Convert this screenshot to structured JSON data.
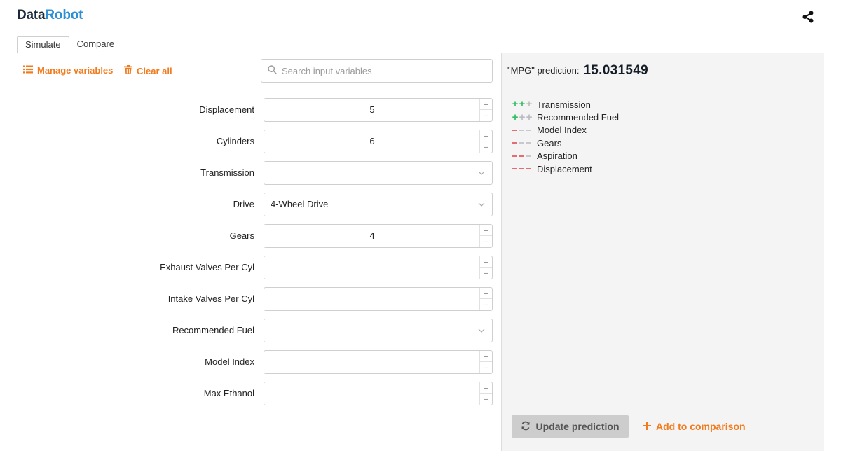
{
  "app": {
    "logo_part1": "Data",
    "logo_part2": "Robot"
  },
  "tabs": [
    {
      "label": "Simulate"
    },
    {
      "label": "Compare"
    }
  ],
  "toolbar": {
    "manage_label": "Manage variables",
    "clear_label": "Clear all",
    "search_placeholder": "Search input variables",
    "search_value": ""
  },
  "fields": [
    {
      "label": "Displacement",
      "type": "number",
      "value": "5"
    },
    {
      "label": "Cylinders",
      "type": "number",
      "value": "6"
    },
    {
      "label": "Transmission",
      "type": "select",
      "value": ""
    },
    {
      "label": "Drive",
      "type": "select",
      "value": "4-Wheel Drive"
    },
    {
      "label": "Gears",
      "type": "number",
      "value": "4"
    },
    {
      "label": "Exhaust Valves Per Cyl",
      "type": "number",
      "value": ""
    },
    {
      "label": "Intake Valves Per Cyl",
      "type": "number",
      "value": ""
    },
    {
      "label": "Recommended Fuel",
      "type": "select",
      "value": ""
    },
    {
      "label": "Model Index",
      "type": "number",
      "value": ""
    },
    {
      "label": "Max Ethanol",
      "type": "number",
      "value": ""
    }
  ],
  "prediction": {
    "label": "\"MPG\" prediction:",
    "value": "15.031549"
  },
  "impacts": [
    {
      "name": "Transmission",
      "direction": "positive",
      "strength": 2
    },
    {
      "name": "Recommended Fuel",
      "direction": "positive",
      "strength": 1
    },
    {
      "name": "Model Index",
      "direction": "negative",
      "strength": 1
    },
    {
      "name": "Gears",
      "direction": "negative",
      "strength": 1
    },
    {
      "name": "Aspiration",
      "direction": "negative",
      "strength": 2
    },
    {
      "name": "Displacement",
      "direction": "negative",
      "strength": 3
    }
  ],
  "actions": {
    "update_label": "Update prediction",
    "add_label": "Add to comparison"
  },
  "colors": {
    "accent": "#f27b1e",
    "brand_blue": "#2d8fd5",
    "positive": "#2fbf63",
    "negative": "#e66b72",
    "muted": "#c6c9cd"
  },
  "icons": {
    "share": "share-icon",
    "list": "list-icon",
    "trash": "trash-icon",
    "search": "search-icon",
    "refresh": "refresh-icon",
    "plus": "plus-icon"
  }
}
